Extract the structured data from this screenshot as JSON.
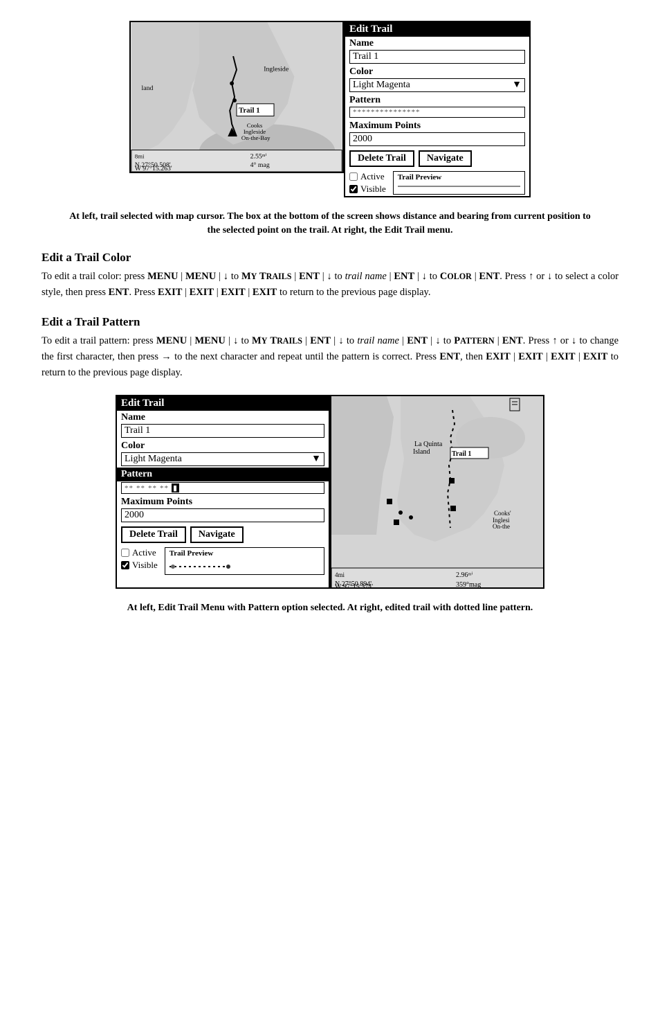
{
  "top": {
    "edit_trail_panel": {
      "title": "Edit Trail",
      "name_label": "Name",
      "name_value": "Trail 1",
      "color_label": "Color",
      "color_value": "Light Magenta",
      "pattern_label": "Pattern",
      "pattern_value": "***************",
      "max_points_label": "Maximum Points",
      "max_points_value": "2000",
      "delete_btn": "Delete Trail",
      "navigate_btn": "Navigate",
      "active_label": "Active",
      "visible_label": "Visible",
      "trail_preview_label": "Trail Preview"
    },
    "caption": "At left, trail selected with map cursor. The box at the bottom of the screen shows distance and bearing from current position to the selected point on the trail. At right, the Edit Trail menu."
  },
  "section1": {
    "header": "Edit a Trail Color",
    "body": "To edit a trail color: press MENU MENU ↓ to My Trails ENT ↓ to trail name ENT ↓ to Color ENT. Press ↑ or ↓ to select a color style, then press ENT. Press EXIT EXIT EXIT EXIT to return to the previous page display."
  },
  "section2": {
    "header": "Edit a Trail Pattern",
    "body": "To edit a trail pattern: press MENU MENU ↓ to My Trails ENT ↓ to trail name ENT ↓ to Pattern ENT. Press ↑ or ↓ to change the first character, then press → to the next character and repeat until the pattern is correct. Press ENT, then EXIT EXIT EXIT EXIT to return to the previous page display."
  },
  "bottom": {
    "edit_trail_panel": {
      "title": "Edit Trail",
      "name_label": "Name",
      "name_value": "Trail 1",
      "color_label": "Color",
      "color_value": "Light Magenta",
      "pattern_label": "Pattern",
      "pattern_value": "**    **    **    **",
      "max_points_label": "Maximum Points",
      "max_points_value": "2000",
      "delete_btn": "Delete Trail",
      "navigate_btn": "Navigate",
      "active_label": "Active",
      "visible_label": "Visible",
      "trail_preview_label": "Trail Preview"
    },
    "caption": "At left, Edit Trail Menu with Pattern option selected. At right, edited trail with dotted line pattern.",
    "right_map": {
      "place1": "La Quinta",
      "place2": "Island",
      "trail_label": "Trail 1",
      "place3": "Cooks'",
      "place4": "Inglesi",
      "place5": "On-the",
      "scale": "4mi",
      "coord_n": "N",
      "coord_w": "W",
      "lat": "27°50.894'",
      "lon": "97°15.374'",
      "dist": "2.96ᵐᴵ",
      "bearing": "359°mag"
    }
  }
}
